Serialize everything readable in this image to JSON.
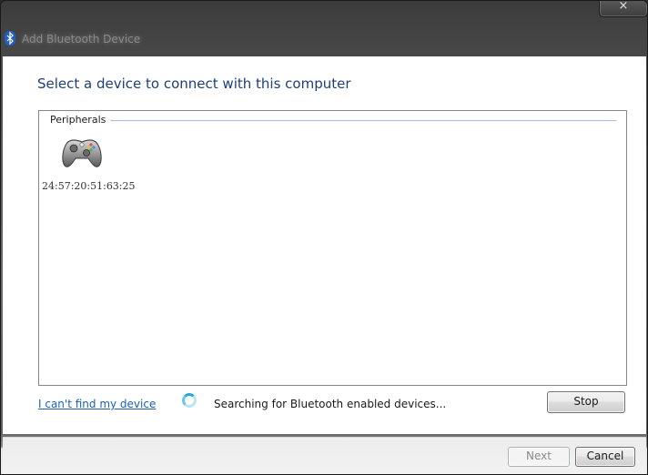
{
  "window": {
    "title": "Add Bluetooth Device",
    "close_glyph": "×",
    "title_icon": "bluetooth-icon"
  },
  "main": {
    "heading": "Select a device to connect with this computer",
    "device_list": {
      "group_header": "Peripherals",
      "devices": [
        {
          "label": "24:57:20:51:63:25",
          "icon": "gamepad-icon"
        }
      ]
    },
    "help_link": "I can't find my device",
    "status": {
      "text": "Searching for Bluetooth enabled devices...",
      "icon": "spinner-icon"
    },
    "stop_label": "Stop"
  },
  "footer": {
    "next_label": "Next",
    "next_enabled": false,
    "cancel_label": "Cancel"
  },
  "colors": {
    "heading": "#1e3f7a",
    "link": "#1b5fb8",
    "group_line": "#a9bfd6",
    "spinner": "#2aa7d8"
  }
}
